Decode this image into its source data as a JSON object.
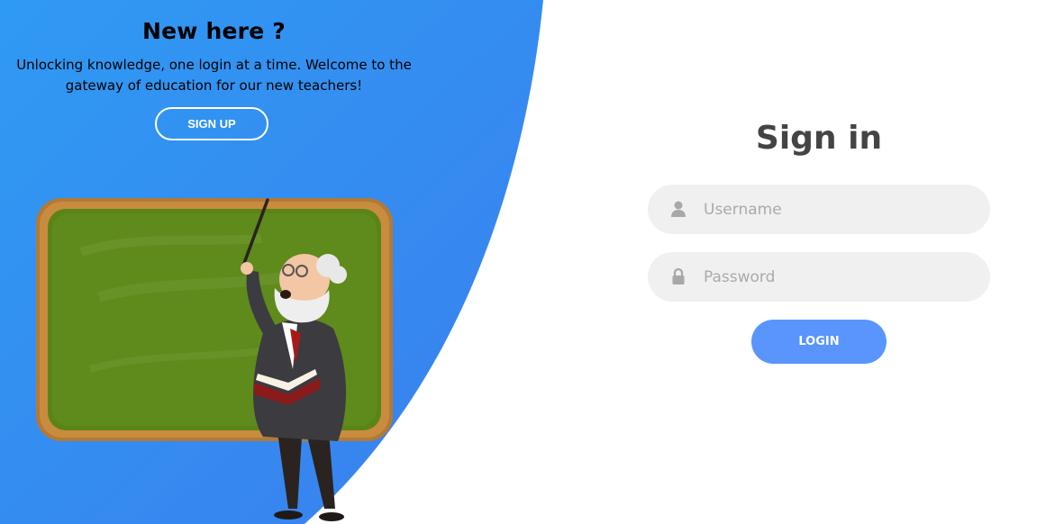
{
  "left_panel": {
    "title": "New here ?",
    "description": "Unlocking knowledge, one login at a time. Welcome to the gateway of education for our new teachers!",
    "signup_label": "SIGN UP"
  },
  "signin": {
    "title": "Sign in",
    "username_placeholder": "Username",
    "username_value": "",
    "password_placeholder": "Password",
    "password_value": "",
    "login_label": "LOGIN"
  },
  "colors": {
    "panel_blue": "#3a8ff0",
    "panel_blue_light": "#2f9af3",
    "accent_button": "#5995fd",
    "input_bg": "#f0f0f0",
    "title_text": "#444444",
    "placeholder_text": "#aaaaaa"
  },
  "icons": {
    "username": "user-icon",
    "password": "lock-icon"
  },
  "illustration": "teacher-at-chalkboard"
}
